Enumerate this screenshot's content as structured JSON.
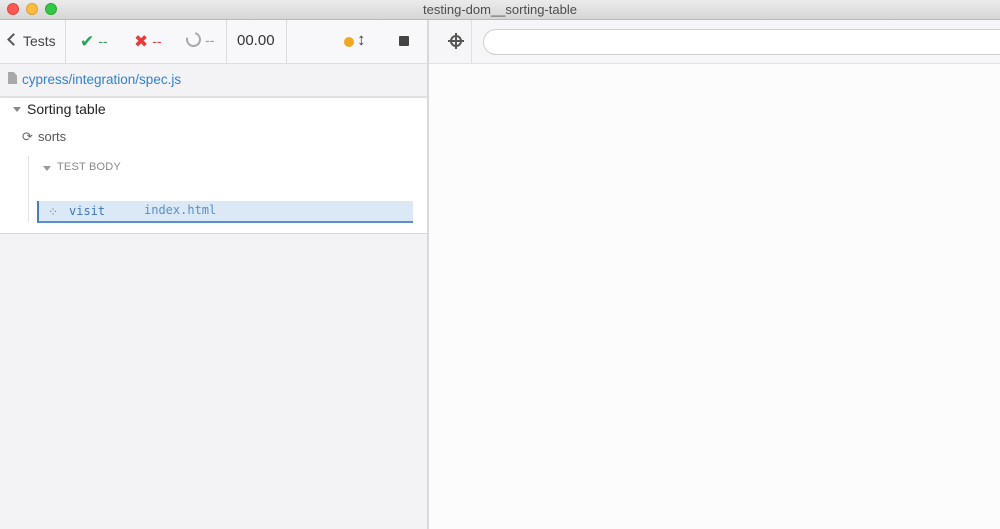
{
  "window": {
    "title": "testing-dom__sorting-table"
  },
  "stats": {
    "tests_label": "Tests",
    "passed": "--",
    "failed": "--",
    "pending": "--",
    "duration": "00.00",
    "colors": {
      "passed": "#2aa15b",
      "failed": "#e53b3b",
      "running_dot": "#f0a821"
    }
  },
  "spec": {
    "path": "cypress/integration/spec.js"
  },
  "runnables": {
    "suite_title": "Sorting table",
    "test_title": "sorts",
    "test_body_label": "TEST BODY",
    "command": {
      "name": "visit",
      "message": "index.html"
    }
  },
  "aut": {
    "url": ""
  },
  "icons": [
    "chevron-left-icon",
    "check-icon",
    "x-icon",
    "pending-ring-icon",
    "running-dot-icon",
    "scroll-toggle-icon",
    "stop-icon",
    "file-icon",
    "caret-down-icon",
    "retry-icon",
    "spinner-icon",
    "selector-playground-icon"
  ]
}
